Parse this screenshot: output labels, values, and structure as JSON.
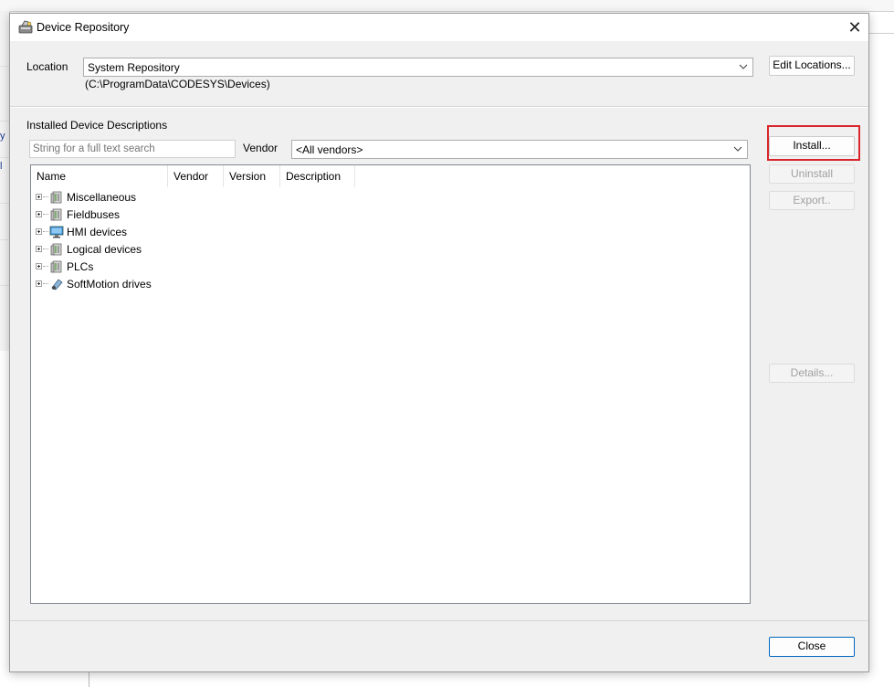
{
  "dialog": {
    "title": "Device Repository",
    "close_glyph": "✕"
  },
  "location": {
    "label": "Location",
    "selected": "System Repository",
    "path": "(C:\\ProgramData\\CODESYS\\Devices)",
    "edit_button": "Edit Locations..."
  },
  "installed": {
    "section_label": "Installed Device Descriptions",
    "search_placeholder": "String for a full text search",
    "vendor_label": "Vendor",
    "vendor_selected": "<All vendors>",
    "columns": [
      "Name",
      "Vendor",
      "Version",
      "Description"
    ],
    "tree_items": [
      {
        "label": "Miscellaneous",
        "icon": "device-folder-icon"
      },
      {
        "label": "Fieldbuses",
        "icon": "device-folder-icon"
      },
      {
        "label": "HMI devices",
        "icon": "monitor-icon"
      },
      {
        "label": "Logical devices",
        "icon": "device-folder-icon"
      },
      {
        "label": "PLCs",
        "icon": "device-folder-icon"
      },
      {
        "label": "SoftMotion drives",
        "icon": "drive-icon"
      }
    ]
  },
  "buttons": {
    "install": "Install...",
    "uninstall": "Uninstall",
    "export": "Export..",
    "details": "Details...",
    "close": "Close"
  },
  "background": {
    "left_edge_text_1": "y",
    "left_edge_text_2": "l"
  },
  "colors": {
    "highlight": "#d8262c",
    "close_button_border": "#0067c0",
    "dialog_bg": "#f0f0f0"
  }
}
